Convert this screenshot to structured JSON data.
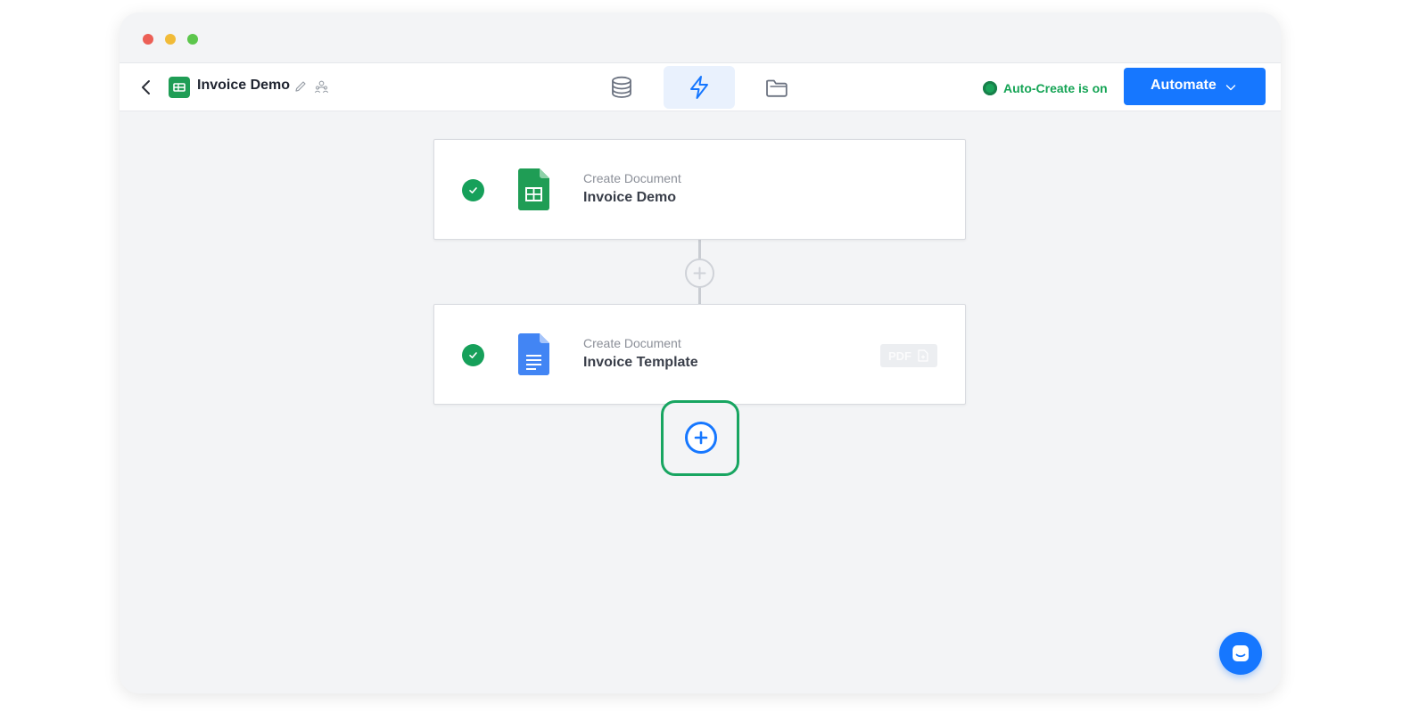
{
  "window": {
    "controls": [
      "close",
      "minimize",
      "zoom"
    ]
  },
  "toolbar": {
    "back_icon": "chevron-left-icon",
    "doc_icon": "sheets-icon",
    "doc_title": "Invoice Demo",
    "edit_icon": "pencil-icon",
    "share_icon": "people-icon",
    "tabs": [
      {
        "icon": "database-icon",
        "active": false
      },
      {
        "icon": "lightning-icon",
        "active": true
      },
      {
        "icon": "folder-icon",
        "active": false
      }
    ],
    "auto_create_status": "Auto-Create is on",
    "automate_label": "Automate",
    "automate_chevron": "chevron-down-icon"
  },
  "flow": {
    "steps": [
      {
        "kind": "Create Document",
        "name": "Invoice Demo",
        "file_icon": "google-sheets-icon",
        "status": "done"
      },
      {
        "kind": "Create Document",
        "name": "Invoice Template",
        "file_icon": "google-docs-icon",
        "status": "done",
        "badge": "PDF"
      }
    ],
    "add_between_icon": "plus-circle-icon",
    "add_step_icon": "plus-circle-icon"
  },
  "chat": {
    "icon": "chat-icon"
  },
  "colors": {
    "accent": "#1677ff",
    "success": "#16a05a",
    "sheets_green": "#1f9d55",
    "docs_blue": "#4285f4",
    "background": "#f3f4f6"
  }
}
